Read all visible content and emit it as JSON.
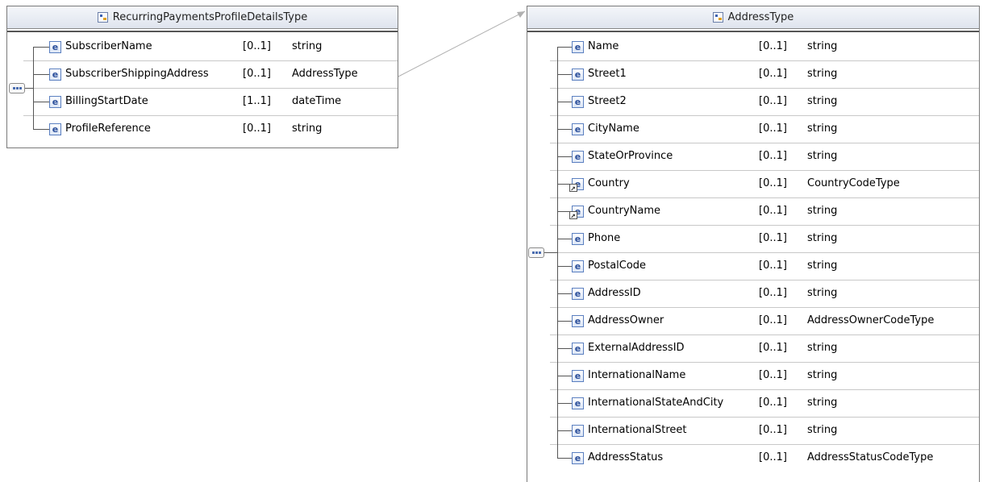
{
  "left_type": {
    "icon": "complex-type-icon",
    "title": "RecurringPaymentsProfileDetailsType",
    "elements": [
      {
        "name": "SubscriberName",
        "cardinality": "[0..1]",
        "type": "string",
        "icon": "element-icon"
      },
      {
        "name": "SubscriberShippingAddress",
        "cardinality": "[0..1]",
        "type": "AddressType",
        "icon": "element-icon"
      },
      {
        "name": "BillingStartDate",
        "cardinality": "[1..1]",
        "type": "dateTime",
        "icon": "element-icon"
      },
      {
        "name": "ProfileReference",
        "cardinality": "[0..1]",
        "type": "string",
        "icon": "element-icon"
      }
    ]
  },
  "right_type": {
    "icon": "complex-type-icon",
    "title": "AddressType",
    "elements": [
      {
        "name": "Name",
        "cardinality": "[0..1]",
        "type": "string",
        "icon": "element-icon"
      },
      {
        "name": "Street1",
        "cardinality": "[0..1]",
        "type": "string",
        "icon": "element-icon"
      },
      {
        "name": "Street2",
        "cardinality": "[0..1]",
        "type": "string",
        "icon": "element-icon"
      },
      {
        "name": "CityName",
        "cardinality": "[0..1]",
        "type": "string",
        "icon": "element-icon"
      },
      {
        "name": "StateOrProvince",
        "cardinality": "[0..1]",
        "type": "string",
        "icon": "element-icon"
      },
      {
        "name": "Country",
        "cardinality": "[0..1]",
        "type": "CountryCodeType",
        "icon": "element-reference-icon"
      },
      {
        "name": "CountryName",
        "cardinality": "[0..1]",
        "type": "string",
        "icon": "element-reference-icon"
      },
      {
        "name": "Phone",
        "cardinality": "[0..1]",
        "type": "string",
        "icon": "element-icon"
      },
      {
        "name": "PostalCode",
        "cardinality": "[0..1]",
        "type": "string",
        "icon": "element-icon"
      },
      {
        "name": "AddressID",
        "cardinality": "[0..1]",
        "type": "string",
        "icon": "element-icon"
      },
      {
        "name": "AddressOwner",
        "cardinality": "[0..1]",
        "type": "AddressOwnerCodeType",
        "icon": "element-icon"
      },
      {
        "name": "ExternalAddressID",
        "cardinality": "[0..1]",
        "type": "string",
        "icon": "element-icon"
      },
      {
        "name": "InternationalName",
        "cardinality": "[0..1]",
        "type": "string",
        "icon": "element-icon"
      },
      {
        "name": "InternationalStateAndCity",
        "cardinality": "[0..1]",
        "type": "string",
        "icon": "element-icon"
      },
      {
        "name": "InternationalStreet",
        "cardinality": "[0..1]",
        "type": "string",
        "icon": "element-icon"
      },
      {
        "name": "AddressStatus",
        "cardinality": "[0..1]",
        "type": "AddressStatusCodeType",
        "icon": "element-icon"
      }
    ]
  },
  "element_icon_letter": "e",
  "sequence_icon": "sequence-compositor-icon"
}
